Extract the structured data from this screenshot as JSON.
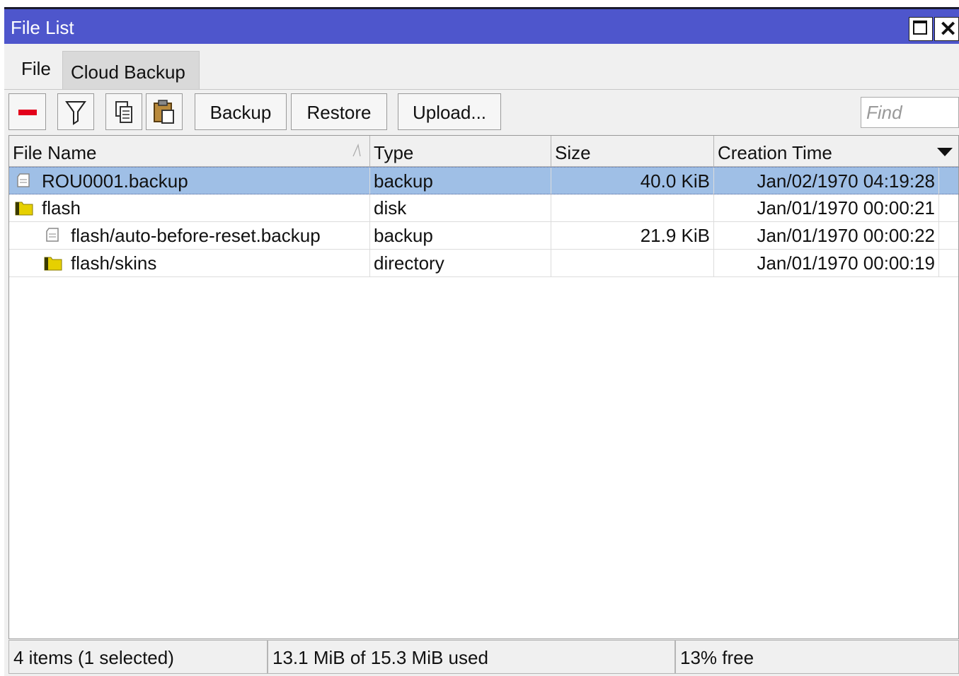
{
  "window": {
    "title": "File List",
    "maximize_icon": "maximize-icon",
    "close_glyph": "✕",
    "title_bg": "#4e56cc"
  },
  "tabs": [
    {
      "label": "File",
      "active": true
    },
    {
      "label": "Cloud Backup",
      "active": false
    }
  ],
  "toolbar": {
    "remove_icon": "minus-icon",
    "filter_icon": "filter-icon",
    "copy_icon": "copy-icon",
    "paste_icon": "paste-icon",
    "backup_label": "Backup",
    "restore_label": "Restore",
    "upload_label": "Upload...",
    "find_placeholder": "Find"
  },
  "table": {
    "columns": [
      "File Name",
      "Type",
      "Size",
      "Creation Time"
    ],
    "sort_column": "File Name",
    "rows": [
      {
        "name": "ROU0001.backup",
        "icon": "document-icon",
        "type": "backup",
        "size": "40.0 KiB",
        "time": "Jan/02/1970 04:19:28",
        "selected": true,
        "indent": 0
      },
      {
        "name": "flash",
        "icon": "folder-icon",
        "type": "disk",
        "size": "",
        "time": "Jan/01/1970 00:00:21",
        "selected": false,
        "indent": 0
      },
      {
        "name": "flash/auto-before-reset.backup",
        "icon": "document-icon",
        "type": "backup",
        "size": "21.9 KiB",
        "time": "Jan/01/1970 00:00:22",
        "selected": false,
        "indent": 1
      },
      {
        "name": "flash/skins",
        "icon": "folder-icon",
        "type": "directory",
        "size": "",
        "time": "Jan/01/1970 00:00:19",
        "selected": false,
        "indent": 1
      }
    ],
    "selection_color": "#9fbfe6"
  },
  "status": {
    "items": "4 items (1 selected)",
    "usage": "13.1 MiB of 15.3 MiB used",
    "free": "13% free"
  }
}
